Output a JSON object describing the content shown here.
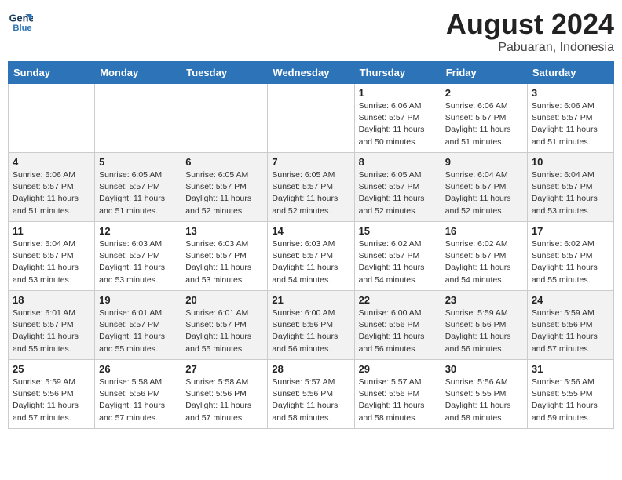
{
  "header": {
    "logo_line1": "General",
    "logo_line2": "Blue",
    "month_year": "August 2024",
    "location": "Pabuaran, Indonesia"
  },
  "weekdays": [
    "Sunday",
    "Monday",
    "Tuesday",
    "Wednesday",
    "Thursday",
    "Friday",
    "Saturday"
  ],
  "weeks": [
    [
      {
        "day": "",
        "sunrise": "",
        "sunset": "",
        "daylight": ""
      },
      {
        "day": "",
        "sunrise": "",
        "sunset": "",
        "daylight": ""
      },
      {
        "day": "",
        "sunrise": "",
        "sunset": "",
        "daylight": ""
      },
      {
        "day": "",
        "sunrise": "",
        "sunset": "",
        "daylight": ""
      },
      {
        "day": "1",
        "sunrise": "Sunrise: 6:06 AM",
        "sunset": "Sunset: 5:57 PM",
        "daylight": "Daylight: 11 hours and 50 minutes."
      },
      {
        "day": "2",
        "sunrise": "Sunrise: 6:06 AM",
        "sunset": "Sunset: 5:57 PM",
        "daylight": "Daylight: 11 hours and 51 minutes."
      },
      {
        "day": "3",
        "sunrise": "Sunrise: 6:06 AM",
        "sunset": "Sunset: 5:57 PM",
        "daylight": "Daylight: 11 hours and 51 minutes."
      }
    ],
    [
      {
        "day": "4",
        "sunrise": "Sunrise: 6:06 AM",
        "sunset": "Sunset: 5:57 PM",
        "daylight": "Daylight: 11 hours and 51 minutes."
      },
      {
        "day": "5",
        "sunrise": "Sunrise: 6:05 AM",
        "sunset": "Sunset: 5:57 PM",
        "daylight": "Daylight: 11 hours and 51 minutes."
      },
      {
        "day": "6",
        "sunrise": "Sunrise: 6:05 AM",
        "sunset": "Sunset: 5:57 PM",
        "daylight": "Daylight: 11 hours and 52 minutes."
      },
      {
        "day": "7",
        "sunrise": "Sunrise: 6:05 AM",
        "sunset": "Sunset: 5:57 PM",
        "daylight": "Daylight: 11 hours and 52 minutes."
      },
      {
        "day": "8",
        "sunrise": "Sunrise: 6:05 AM",
        "sunset": "Sunset: 5:57 PM",
        "daylight": "Daylight: 11 hours and 52 minutes."
      },
      {
        "day": "9",
        "sunrise": "Sunrise: 6:04 AM",
        "sunset": "Sunset: 5:57 PM",
        "daylight": "Daylight: 11 hours and 52 minutes."
      },
      {
        "day": "10",
        "sunrise": "Sunrise: 6:04 AM",
        "sunset": "Sunset: 5:57 PM",
        "daylight": "Daylight: 11 hours and 53 minutes."
      }
    ],
    [
      {
        "day": "11",
        "sunrise": "Sunrise: 6:04 AM",
        "sunset": "Sunset: 5:57 PM",
        "daylight": "Daylight: 11 hours and 53 minutes."
      },
      {
        "day": "12",
        "sunrise": "Sunrise: 6:03 AM",
        "sunset": "Sunset: 5:57 PM",
        "daylight": "Daylight: 11 hours and 53 minutes."
      },
      {
        "day": "13",
        "sunrise": "Sunrise: 6:03 AM",
        "sunset": "Sunset: 5:57 PM",
        "daylight": "Daylight: 11 hours and 53 minutes."
      },
      {
        "day": "14",
        "sunrise": "Sunrise: 6:03 AM",
        "sunset": "Sunset: 5:57 PM",
        "daylight": "Daylight: 11 hours and 54 minutes."
      },
      {
        "day": "15",
        "sunrise": "Sunrise: 6:02 AM",
        "sunset": "Sunset: 5:57 PM",
        "daylight": "Daylight: 11 hours and 54 minutes."
      },
      {
        "day": "16",
        "sunrise": "Sunrise: 6:02 AM",
        "sunset": "Sunset: 5:57 PM",
        "daylight": "Daylight: 11 hours and 54 minutes."
      },
      {
        "day": "17",
        "sunrise": "Sunrise: 6:02 AM",
        "sunset": "Sunset: 5:57 PM",
        "daylight": "Daylight: 11 hours and 55 minutes."
      }
    ],
    [
      {
        "day": "18",
        "sunrise": "Sunrise: 6:01 AM",
        "sunset": "Sunset: 5:57 PM",
        "daylight": "Daylight: 11 hours and 55 minutes."
      },
      {
        "day": "19",
        "sunrise": "Sunrise: 6:01 AM",
        "sunset": "Sunset: 5:57 PM",
        "daylight": "Daylight: 11 hours and 55 minutes."
      },
      {
        "day": "20",
        "sunrise": "Sunrise: 6:01 AM",
        "sunset": "Sunset: 5:57 PM",
        "daylight": "Daylight: 11 hours and 55 minutes."
      },
      {
        "day": "21",
        "sunrise": "Sunrise: 6:00 AM",
        "sunset": "Sunset: 5:56 PM",
        "daylight": "Daylight: 11 hours and 56 minutes."
      },
      {
        "day": "22",
        "sunrise": "Sunrise: 6:00 AM",
        "sunset": "Sunset: 5:56 PM",
        "daylight": "Daylight: 11 hours and 56 minutes."
      },
      {
        "day": "23",
        "sunrise": "Sunrise: 5:59 AM",
        "sunset": "Sunset: 5:56 PM",
        "daylight": "Daylight: 11 hours and 56 minutes."
      },
      {
        "day": "24",
        "sunrise": "Sunrise: 5:59 AM",
        "sunset": "Sunset: 5:56 PM",
        "daylight": "Daylight: 11 hours and 57 minutes."
      }
    ],
    [
      {
        "day": "25",
        "sunrise": "Sunrise: 5:59 AM",
        "sunset": "Sunset: 5:56 PM",
        "daylight": "Daylight: 11 hours and 57 minutes."
      },
      {
        "day": "26",
        "sunrise": "Sunrise: 5:58 AM",
        "sunset": "Sunset: 5:56 PM",
        "daylight": "Daylight: 11 hours and 57 minutes."
      },
      {
        "day": "27",
        "sunrise": "Sunrise: 5:58 AM",
        "sunset": "Sunset: 5:56 PM",
        "daylight": "Daylight: 11 hours and 57 minutes."
      },
      {
        "day": "28",
        "sunrise": "Sunrise: 5:57 AM",
        "sunset": "Sunset: 5:56 PM",
        "daylight": "Daylight: 11 hours and 58 minutes."
      },
      {
        "day": "29",
        "sunrise": "Sunrise: 5:57 AM",
        "sunset": "Sunset: 5:56 PM",
        "daylight": "Daylight: 11 hours and 58 minutes."
      },
      {
        "day": "30",
        "sunrise": "Sunrise: 5:56 AM",
        "sunset": "Sunset: 5:55 PM",
        "daylight": "Daylight: 11 hours and 58 minutes."
      },
      {
        "day": "31",
        "sunrise": "Sunrise: 5:56 AM",
        "sunset": "Sunset: 5:55 PM",
        "daylight": "Daylight: 11 hours and 59 minutes."
      }
    ]
  ]
}
